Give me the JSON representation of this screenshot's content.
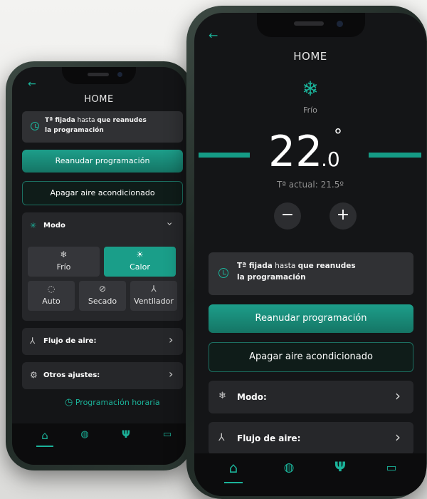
{
  "colors": {
    "accent": "#1bb39a",
    "primary_button": "#157565",
    "background": "#141517",
    "card": "#26272a"
  },
  "back_phone": {
    "title": "HOME",
    "info": {
      "bold1": "Tª fijada",
      "normal1": " hasta ",
      "bold2": "que reanudes",
      "line2": "la programación"
    },
    "resume_button": "Reanudar programación",
    "off_button": "Apagar aire acondicionado",
    "mode_section": {
      "label": "Modo",
      "icon": "snowflake-icon",
      "chevron": "chevron-down-icon"
    },
    "modes": [
      {
        "label": "Frío",
        "icon": "snowflake-icon",
        "active": false
      },
      {
        "label": "Calor",
        "icon": "sun-icon",
        "active": true
      },
      {
        "label": "Auto",
        "icon": "auto-cycle-icon",
        "active": false
      },
      {
        "label": "Secado",
        "icon": "drop-slash-icon",
        "active": false
      },
      {
        "label": "Ventilador",
        "icon": "fan-icon",
        "active": false
      }
    ],
    "airflow_row": "Flujo de aire:",
    "other_row": "Otros ajustes:",
    "schedule_link": "Programación horaria",
    "nav": [
      "home-icon",
      "remote-icon",
      "tools-icon",
      "chat-icon"
    ]
  },
  "front_phone": {
    "title": "HOME",
    "mode_icon": "snowflake-icon",
    "mode_label": "Frío",
    "temperature": {
      "integer": "22",
      "decimal": ".0",
      "degree": "°"
    },
    "current_temp": "Tª actual: 21.5º",
    "minus": "−",
    "plus": "+",
    "info": {
      "bold1": "Tª fijada",
      "normal1": " hasta ",
      "bold2": "que reanudes",
      "line2": "la programación"
    },
    "resume_button": "Reanudar programación",
    "off_button": "Apagar aire acondicionado",
    "mode_row": "Modo:",
    "airflow_row": "Flujo de aire:",
    "nav": [
      "home-icon",
      "remote-icon",
      "tools-icon",
      "chat-icon"
    ]
  }
}
